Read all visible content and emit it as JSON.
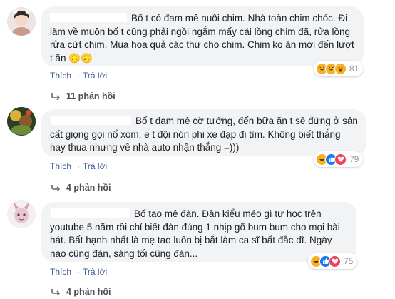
{
  "comments": [
    {
      "text": "Bố t có đam mê nuôi chim. Nhà toàn chim chóc. Đi làm về muộn bố t cũng phải ngồi ngắm mấy cái lồng chim đã, rửa lồng rửa cứt chim. Mua hoa quả các thứ cho chim. Chim ko ăn mới đến lượt t ăn 🙃🙃",
      "reaction_count": "81",
      "reactions": [
        "haha",
        "haha",
        "wow"
      ],
      "actions": {
        "like": "Thích",
        "reply": "Trả lời"
      },
      "replies": "11 phản hồi"
    },
    {
      "text": "Bố t đam mê cờ tướng, đến bữa ăn t sẽ đứng ở sân cất giọng gọi nổ xóm, e t đội nón phi xe đạp đi tìm. Không biết thắng hay thua nhưng về nhà auto nhận thắng =)))",
      "reaction_count": "79",
      "reactions": [
        "haha",
        "like",
        "love"
      ],
      "actions": {
        "like": "Thích",
        "reply": "Trả lời"
      },
      "replies": "4 phản hồi"
    },
    {
      "text": "Bố tao mê đàn. Đàn kiểu méo gì tự học trên youtube 5 năm rồi chỉ biết đàn đúng 1 nhịp gõ bum bum cho mọi bài hát. Bất hạnh nhất là mẹ tao luôn bị bắt làm ca sĩ bất đắc dĩ. Ngày nào cũng đàn, sáng tối cũng đàn...",
      "reaction_count": "75",
      "reactions": [
        "haha",
        "like",
        "love"
      ],
      "actions": {
        "like": "Thích",
        "reply": "Trả lời"
      },
      "replies": "4 phản hồi"
    }
  ],
  "colors": {
    "bubble": "#f2f3f5",
    "link": "#385898",
    "muted": "#90949c",
    "like": "#1877f2",
    "love": "#f33e58",
    "haha": "#f7b125"
  }
}
